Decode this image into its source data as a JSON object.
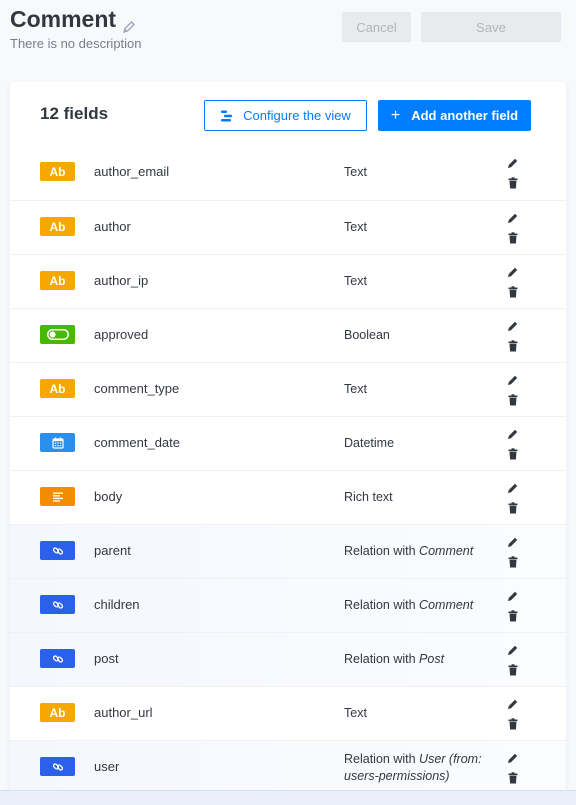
{
  "header": {
    "title": "Comment",
    "description": "There is no description",
    "cancel_label": "Cancel",
    "save_label": "Save"
  },
  "list": {
    "count_label": "12 fields",
    "configure_label": "Configure the view",
    "add_label": "Add another field"
  },
  "colors": {
    "accent": "#007eff",
    "text": "#f6a800",
    "boolean": "#47b900",
    "datetime": "#2a8fec",
    "richtext": "#f58b00",
    "relation": "#2b60ea"
  },
  "fields": [
    {
      "name": "author_email",
      "type": "Text",
      "icon": "text-icon"
    },
    {
      "name": "author",
      "type": "Text",
      "icon": "text-icon"
    },
    {
      "name": "author_ip",
      "type": "Text",
      "icon": "text-icon"
    },
    {
      "name": "approved",
      "type": "Boolean",
      "icon": "toggle-icon"
    },
    {
      "name": "comment_type",
      "type": "Text",
      "icon": "text-icon"
    },
    {
      "name": "comment_date",
      "type": "Datetime",
      "icon": "calendar-icon"
    },
    {
      "name": "body",
      "type": "Rich text",
      "icon": "richtext-icon"
    },
    {
      "name": "parent",
      "type": "Relation with ",
      "target": "Comment",
      "icon": "link-icon"
    },
    {
      "name": "children",
      "type": "Relation with ",
      "target": "Comment",
      "icon": "link-icon"
    },
    {
      "name": "post",
      "type": "Relation with ",
      "target": "Post",
      "icon": "link-icon"
    },
    {
      "name": "author_url",
      "type": "Text",
      "icon": "text-icon"
    },
    {
      "name": "user",
      "type": "Relation with ",
      "target": "User (from: users-permissions)",
      "icon": "link-icon"
    }
  ],
  "badges": {
    "text_label": "Ab"
  }
}
